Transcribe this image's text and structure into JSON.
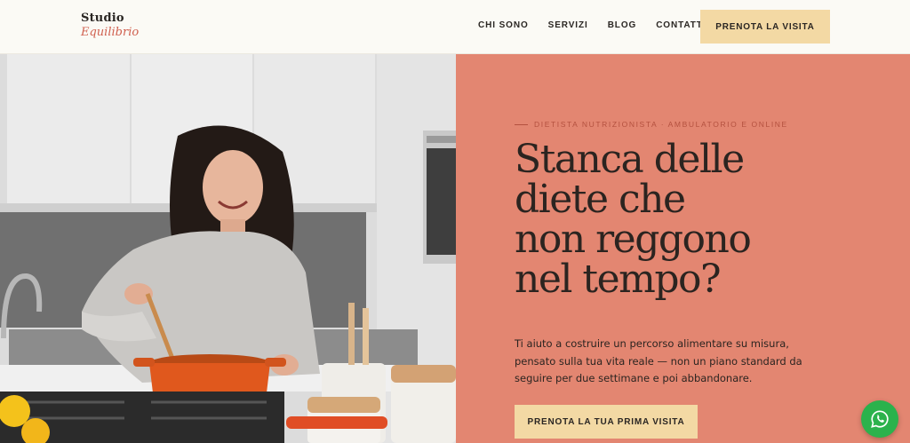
{
  "logo": {
    "line1": "Studio",
    "line2": "Equilibrio"
  },
  "nav": {
    "items": [
      "CHI SONO",
      "SERVIZI",
      "BLOG",
      "CONTATTI"
    ],
    "cta": "PRENOTA LA VISITA"
  },
  "hero": {
    "eyebrow": "DIETISTA NUTRIZIONISTA · AMBULATORIO E ONLINE",
    "headline": [
      "Stanca delle",
      "diete che",
      "non reggono",
      "nel tempo?"
    ],
    "subtext": "Ti aiuto a costruire un percorso alimentare su misura, pensato sulla tua vita reale — non un piano standard da seguire per due settimane e poi abbandonare.",
    "cta": "PRENOTA LA TUA PRIMA VISITA",
    "image_icon": "woman-cooking-photo"
  },
  "chat": {
    "icon": "whatsapp-icon"
  },
  "colors": {
    "panel": "#e38671",
    "button": "#f3d9a4",
    "accent": "#d0604f",
    "whatsapp": "#2bb24c"
  }
}
